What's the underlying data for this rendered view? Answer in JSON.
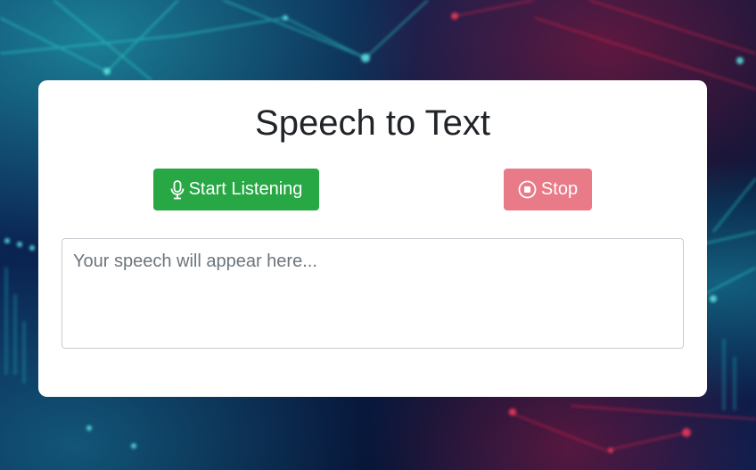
{
  "page": {
    "title": "Speech to Text"
  },
  "controls": {
    "start_label": "Start Listening",
    "start_icon": "microphone-icon",
    "stop_label": "Stop",
    "stop_icon": "stop-circle-icon"
  },
  "output": {
    "placeholder": "Your speech will appear here...",
    "value": ""
  },
  "colors": {
    "start_button": "#28a745",
    "stop_button": "#e97a87",
    "card_background": "#ffffff"
  }
}
